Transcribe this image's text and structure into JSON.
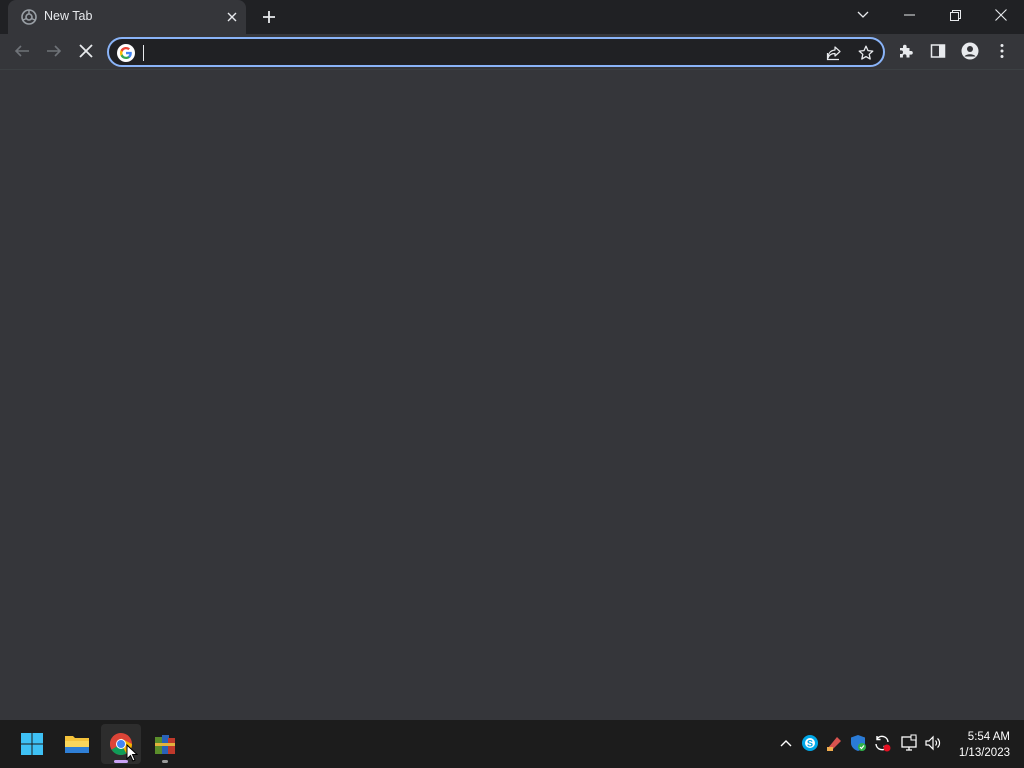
{
  "browser": {
    "tab": {
      "title": "New Tab",
      "favicon": "chrome-loading-icon"
    },
    "window_controls": [
      "tab-search-icon",
      "minimize-icon",
      "restore-icon",
      "close-icon"
    ],
    "toolbar": {
      "buttons": [
        "back-arrow-icon",
        "forward-arrow-icon",
        "stop-loading-icon"
      ],
      "right_buttons": [
        "extensions-icon",
        "side-panel-icon",
        "profile-icon",
        "menu-icon"
      ]
    },
    "omnibox": {
      "value": "",
      "search_engine_icon": "google-g-icon",
      "actions": [
        "share-icon",
        "bookmark-star-icon"
      ]
    }
  },
  "taskbar": {
    "apps": [
      "windows-start-icon",
      "file-explorer-icon",
      "chrome-icon",
      "winrar-icon"
    ],
    "tray": [
      "chevron-up-icon",
      "skype-icon",
      "ccleaner-icon",
      "windows-security-icon",
      "sync-icon",
      "network-icon",
      "volume-icon"
    ],
    "time": "5:54 AM",
    "date": "1/13/2023"
  },
  "colors": {
    "titlebar": "#202124",
    "tab_active": "#35363a",
    "omnibox_border": "#8ab4f8",
    "taskbar": "#1c1c1c"
  }
}
